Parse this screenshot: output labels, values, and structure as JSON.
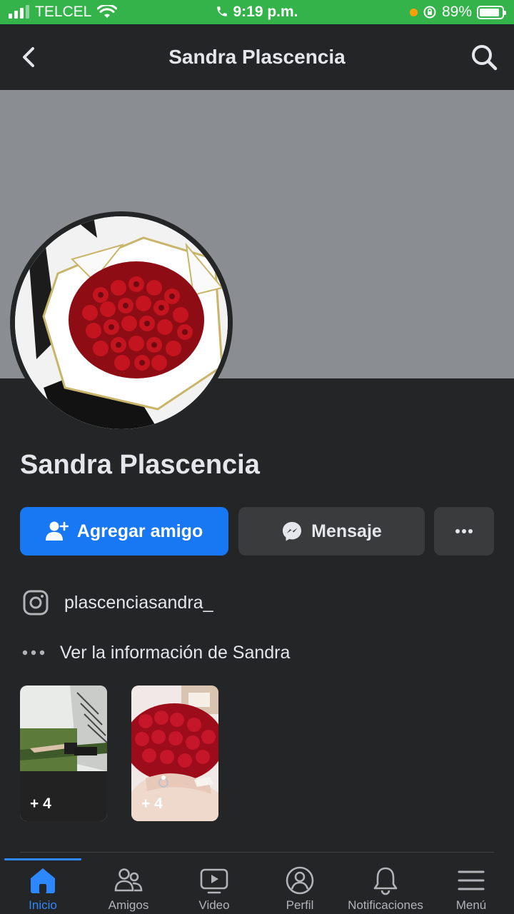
{
  "status_bar": {
    "carrier": "TELCEL",
    "time": "9:19 p.m.",
    "battery": "89%",
    "battery_level": 0.89
  },
  "header": {
    "title": "Sandra Plascencia",
    "back_icon": "chevron-left-icon",
    "search_icon": "search-icon"
  },
  "profile": {
    "name": "Sandra Plascencia",
    "add_friend_label": "Agregar amigo",
    "message_label": "Mensaje",
    "instagram_handle": "plascenciasandra_",
    "see_info_label": "Ver la información de Sandra"
  },
  "highlights": [
    {
      "count": "+ 4"
    },
    {
      "count": "+ 4"
    }
  ],
  "tabs": [
    {
      "label": "Inicio",
      "icon": "home-icon",
      "active": true
    },
    {
      "label": "Amigos",
      "icon": "friends-icon",
      "active": false
    },
    {
      "label": "Video",
      "icon": "video-icon",
      "active": false
    },
    {
      "label": "Perfil",
      "icon": "profile-icon",
      "active": false
    },
    {
      "label": "Notificaciones",
      "icon": "bell-icon",
      "active": false
    },
    {
      "label": "Menú",
      "icon": "menu-icon",
      "active": false
    }
  ],
  "colors": {
    "status_bar": "#34b34a",
    "accent": "#1877f2",
    "background": "#242526"
  }
}
